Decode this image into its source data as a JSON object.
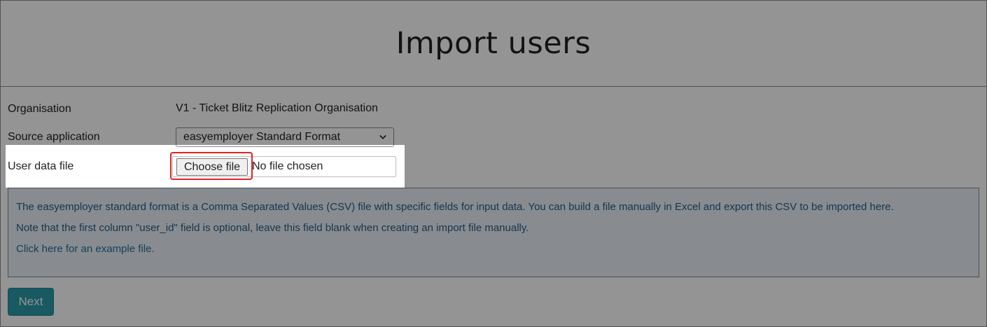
{
  "header": {
    "title": "Import users"
  },
  "form": {
    "organisation_label": "Organisation",
    "organisation_value": "V1 - Ticket Blitz Replication Organisation",
    "source_label": "Source application",
    "source_selected": "easyemployer Standard Format",
    "file_label": "User data file",
    "choose_file_label": "Choose file",
    "no_file_text": "No file chosen"
  },
  "info": {
    "line1": "The easyemployer standard format is a Comma Separated Values (CSV) file with specific fields for input data.  You can build a file manually in Excel and export this CSV to be imported here.",
    "line2": "Note that the first column \"user_id\" field is optional, leave this field blank when creating an import file manually.",
    "link_text": "Click here for an example file."
  },
  "actions": {
    "next_label": "Next"
  },
  "icons": {
    "select_chevron": "chevron-down-icon"
  },
  "colors": {
    "next_button": "#2a9aaa",
    "info_text": "#2b5a83",
    "highlight_outline": "#e02424"
  }
}
